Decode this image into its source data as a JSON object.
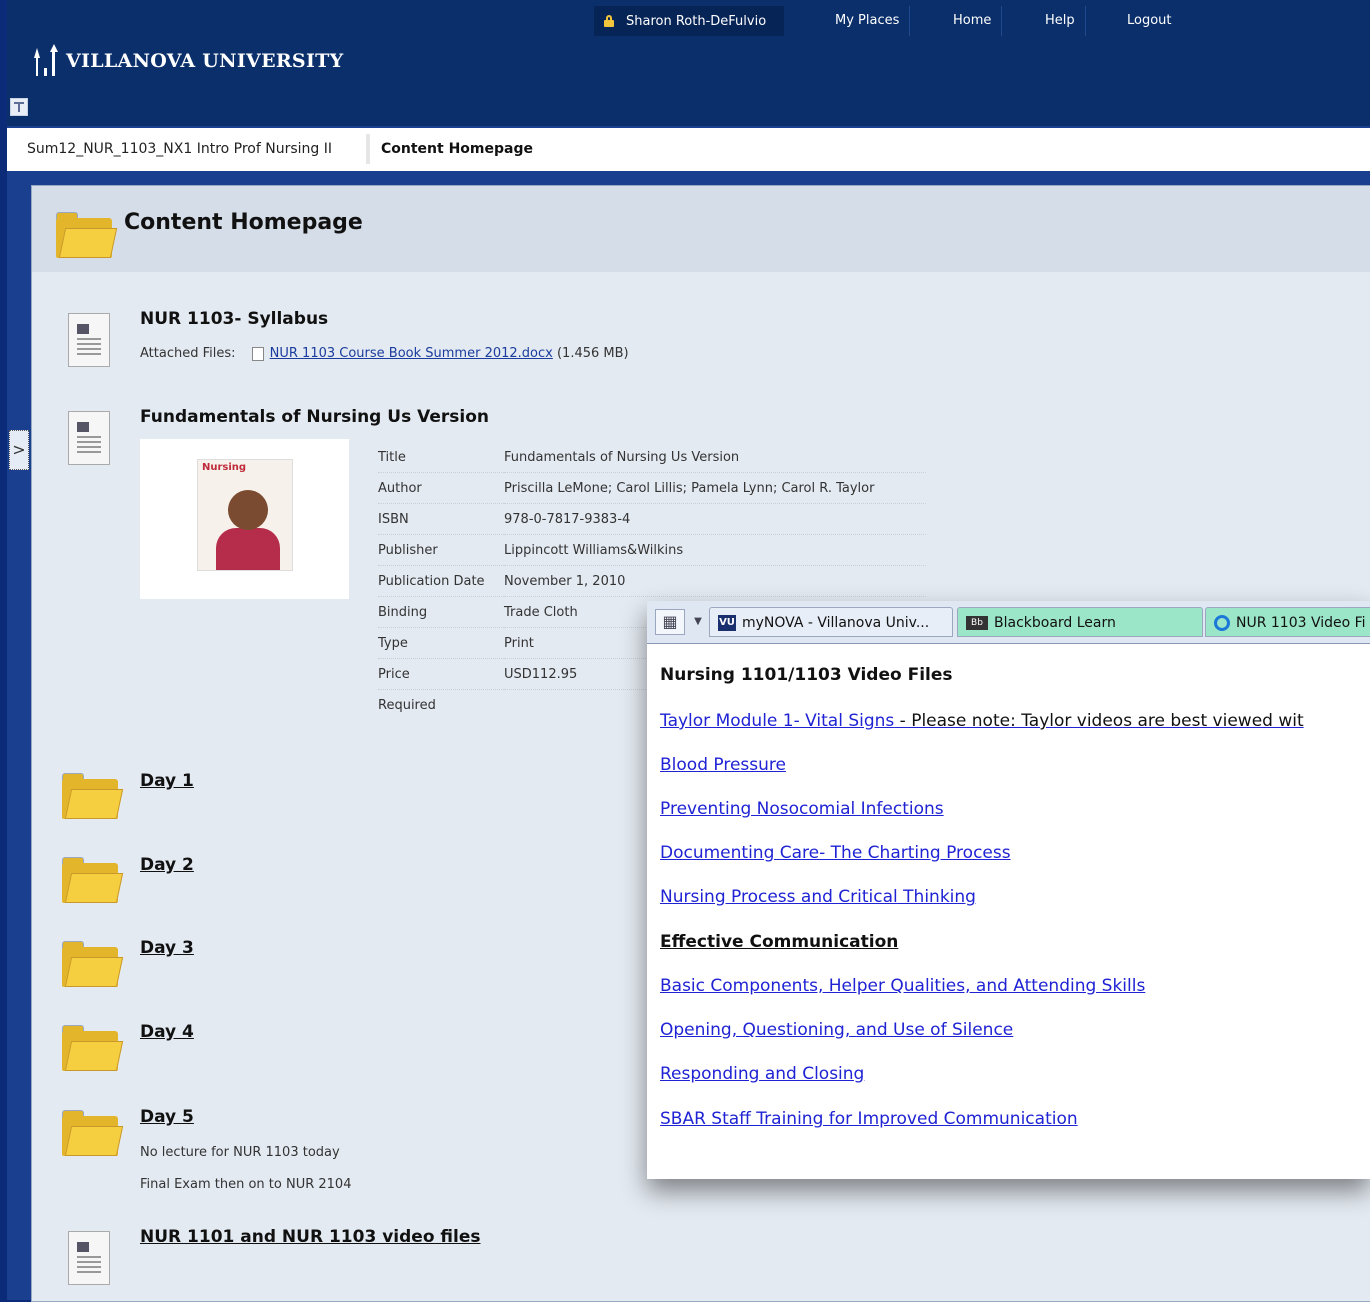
{
  "topnav": {
    "user": "Sharon Roth-DeFulvio",
    "my_places": "My Places",
    "home": "Home",
    "help": "Help",
    "logout": "Logout"
  },
  "brand": {
    "name": "VILLANOVA UNIVERSITY"
  },
  "breadcrumb": {
    "course": "Sum12_NUR_1103_NX1 Intro Prof Nursing II",
    "current": "Content Homepage"
  },
  "page": {
    "title": "Content Homepage"
  },
  "syllabus": {
    "title": "NUR 1103- Syllabus",
    "attached_label": "Attached Files:",
    "file_name": "NUR 1103 Course Book Summer 2012.docx",
    "file_size": "(1.456 MB)"
  },
  "textbook": {
    "title": "Fundamentals of Nursing Us Version",
    "cover_title": "Nursing",
    "fields": [
      {
        "key": "Title",
        "value": "Fundamentals of Nursing Us Version"
      },
      {
        "key": "Author",
        "value": "Priscilla LeMone; Carol Lillis; Pamela Lynn; Carol R. Taylor"
      },
      {
        "key": "ISBN",
        "value": "978-0-7817-9383-4"
      },
      {
        "key": "Publisher",
        "value": "Lippincott Williams&Wilkins"
      },
      {
        "key": "Publication Date",
        "value": "November 1, 2010"
      },
      {
        "key": "Binding",
        "value": "Trade Cloth"
      },
      {
        "key": "Type",
        "value": "Print"
      },
      {
        "key": "Price",
        "value": "USD112.95"
      },
      {
        "key": "Required",
        "value": ""
      }
    ]
  },
  "days": [
    {
      "label": "Day 1"
    },
    {
      "label": "Day 2"
    },
    {
      "label": "Day 3"
    },
    {
      "label": "Day 4"
    },
    {
      "label": "Day 5",
      "note1": "No lecture for NUR 1103 today",
      "note2": "Final Exam then on to NUR 2104"
    }
  ],
  "video_files_item": {
    "title": "NUR 1101 and NUR 1103 video files"
  },
  "browser": {
    "tabs": [
      {
        "label": "myNOVA - Villanova Univ..."
      },
      {
        "label": "Blackboard Learn"
      },
      {
        "label": "NUR 1103 Video Fi"
      }
    ],
    "vu_badge": "VU",
    "bb_badge": "Bb"
  },
  "popup": {
    "title": "Nursing 1101/1103 Video Files",
    "first_link": "Taylor Module 1- Vital Signs",
    "first_link_note": " - Please note: Taylor videos are best viewed wit",
    "links": [
      "Blood Pressure",
      "Preventing Nosocomial Infections",
      "Documenting Care- The Charting Process",
      "Nursing Process and Critical Thinking"
    ],
    "section_heading": "Effective Communication",
    "section_links": [
      "Basic Components, Helper Qualities, and Attending Skills",
      "Opening, Questioning, and Use of Silence",
      "Responding and Closing",
      "SBAR Staff Training for Improved Communication"
    ]
  }
}
